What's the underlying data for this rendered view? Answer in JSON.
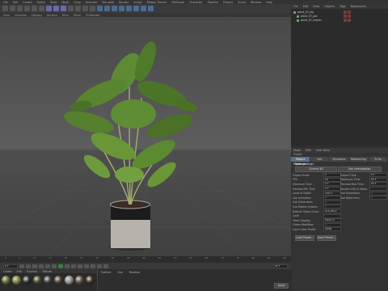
{
  "menubar": {
    "items": [
      "File",
      "Edit",
      "Create",
      "Select",
      "Tools",
      "Mesh",
      "Snap",
      "Animate",
      "Simulate",
      "Render",
      "Sculpt",
      "Motion Tracker",
      "MoGraph",
      "Character",
      "Pipeline",
      "Plugins",
      "Script",
      "Window",
      "Help"
    ]
  },
  "toolbar": {
    "tool_icons": [
      "undo-icon",
      "redo-icon",
      "live-select-icon",
      "move-icon",
      "scale-icon",
      "rotate-icon",
      "x-axis-icon",
      "y-axis-icon",
      "z-axis-icon",
      "coord-system-icon",
      "render-view-icon",
      "render-picture-icon",
      "render-settings-icon",
      "cube-icon",
      "pen-icon",
      "subdivision-icon",
      "array-icon",
      "deformer-icon",
      "floor-icon",
      "camera-icon",
      "light-icon"
    ]
  },
  "viewport": {
    "menu": [
      "View",
      "Cameras",
      "Display",
      "Options",
      "Filter",
      "Panel",
      "ProRender"
    ]
  },
  "object_manager": {
    "menu": [
      "File",
      "Edit",
      "View",
      "Objects",
      "Tags",
      "Bookmarks"
    ],
    "objects": [
      {
        "name": "plant_07_obj",
        "level": 0
      },
      {
        "name": "plant_07_pot",
        "level": 1
      },
      {
        "name": "plant_07_leaves",
        "level": 1
      }
    ]
  },
  "attributes": {
    "menu": [
      "Mode",
      "Edit",
      "User Data"
    ],
    "object_label": "Project",
    "tabs": [
      "Project Settings",
      "Info",
      "Dynamics",
      "Referencing",
      "To Do"
    ],
    "section_title": "Project Settings",
    "buttons": {
      "cinema4d": "Cinema 4D",
      "key_interpolation": "Key Interpolation"
    },
    "left_fields": [
      {
        "label": "Project Scale",
        "value": "1"
      },
      {
        "label": "FPS",
        "value": "30"
      },
      {
        "label": "Minimum Time",
        "value": "0 F"
      },
      {
        "label": "Preview Min Time",
        "value": "0 F"
      },
      {
        "label": "Level of Detail",
        "value": "100 %"
      },
      {
        "label": "Use Animation",
        "value": "✓"
      },
      {
        "label": "Use Generators",
        "value": "✓"
      },
      {
        "label": "Use Motion System",
        "value": "✓"
      },
      {
        "label": "Default Object Color",
        "value": "Gray-Blue"
      },
      {
        "label": "Color",
        "value": ""
      },
      {
        "label": "View Clipping",
        "value": "Medium"
      },
      {
        "label": "Linear Workflow",
        "value": "✓"
      },
      {
        "label": "Input Color Profile",
        "value": "sRGB"
      }
    ],
    "right_fields": [
      {
        "label": "Project Time",
        "value": "0 F"
      },
      {
        "label": "Maximum Time",
        "value": "90 F"
      },
      {
        "label": "Preview Max Time",
        "value": "90 F"
      },
      {
        "label": "Render LOD in Editor",
        "value": ""
      },
      {
        "label": "Use Expression",
        "value": "✓"
      },
      {
        "label": "Use Deformers",
        "value": "✓"
      }
    ],
    "bottom_buttons": [
      "Load Preset...",
      "Save Preset..."
    ]
  },
  "timeline": {
    "ticks": [
      "0",
      "5",
      "10",
      "15",
      "20",
      "25",
      "30",
      "35",
      "40",
      "45",
      "50",
      "55",
      "60",
      "65",
      "70",
      "75",
      "80",
      "85",
      "90"
    ],
    "current_frame": "0 F",
    "end_frame": "90 F"
  },
  "material_manager": {
    "menu": [
      "Create",
      "Edit",
      "Function",
      "Texture"
    ],
    "swatches": [
      "#5b6b2a",
      "#7d7d3a",
      "#2b2b2b",
      "#404a1e",
      "#3a3a3a",
      "#4b3a2e",
      "#8f8f8f",
      "#5e4b3b",
      "#3c2c25"
    ]
  },
  "coordinates": {
    "menu": [
      "Position",
      "Size",
      "Rotation"
    ],
    "apply_label": "Apply"
  },
  "colors": {
    "accent": "#5a6f87"
  }
}
